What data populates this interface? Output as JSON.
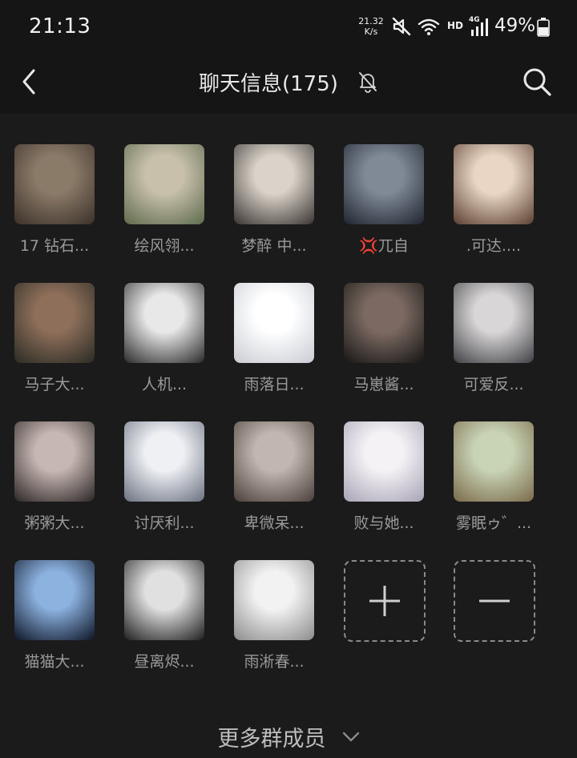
{
  "status_bar": {
    "time": "21:13",
    "net_speed_value": "21.32",
    "net_speed_unit": "K/s",
    "hd": "HD",
    "network": "4G",
    "battery": "49%"
  },
  "header": {
    "title": "聊天信息(175)",
    "icons": [
      "back-chevron",
      "bell-off",
      "search"
    ]
  },
  "members": [
    {
      "name": "17 钻石...",
      "avatar_colors": [
        "#8a7a68",
        "#3c3129"
      ]
    },
    {
      "name": "绘风翎...",
      "avatar_colors": [
        "#c8c0ab",
        "#5e6b4c"
      ]
    },
    {
      "name": "梦醉 中...",
      "avatar_colors": [
        "#d9d3c9",
        "#3a3532"
      ]
    },
    {
      "name": "💢兀自",
      "avatar_colors": [
        "#7f8a96",
        "#1f2430"
      ]
    },
    {
      "name": ".可达....",
      "avatar_colors": [
        "#e9d6c4",
        "#5a3f31"
      ]
    },
    {
      "name": "马子大...",
      "avatar_colors": [
        "#8e6f5a",
        "#2a2b24"
      ]
    },
    {
      "name": "人机...",
      "avatar_colors": [
        "#e8e8e8",
        "#2a2a2a"
      ]
    },
    {
      "name": "雨落日...",
      "avatar_colors": [
        "#ffffff",
        "#c9ccd3"
      ]
    },
    {
      "name": "马崽酱...",
      "avatar_colors": [
        "#7c6a62",
        "#161514"
      ]
    },
    {
      "name": "可爱反...",
      "avatar_colors": [
        "#d8d6d6",
        "#404045"
      ]
    },
    {
      "name": "粥粥大...",
      "avatar_colors": [
        "#c7b7b2",
        "#2b2626"
      ]
    },
    {
      "name": "讨厌利...",
      "avatar_colors": [
        "#eef0f4",
        "#6b7180"
      ]
    },
    {
      "name": "卑微呆...",
      "avatar_colors": [
        "#c2b6b0",
        "#4a3f3a"
      ]
    },
    {
      "name": "败与她...",
      "avatar_colors": [
        "#f4f2f5",
        "#a9a3b6"
      ]
    },
    {
      "name": "雾眠ゥ゛...",
      "avatar_colors": [
        "#c9d4b6",
        "#7a6a4a"
      ]
    },
    {
      "name": "猫猫大...",
      "avatar_colors": [
        "#8cb2e0",
        "#0d1526"
      ]
    },
    {
      "name": "昼离烬...",
      "avatar_colors": [
        "#e0e0e0",
        "#1e1e1e"
      ]
    },
    {
      "name": "雨淅春...",
      "avatar_colors": [
        "#f2f2f2",
        "#8c8c8c"
      ]
    }
  ],
  "actions": {
    "add_icon": "plus",
    "remove_icon": "minus"
  },
  "footer": {
    "more_label": "更多群成员"
  }
}
